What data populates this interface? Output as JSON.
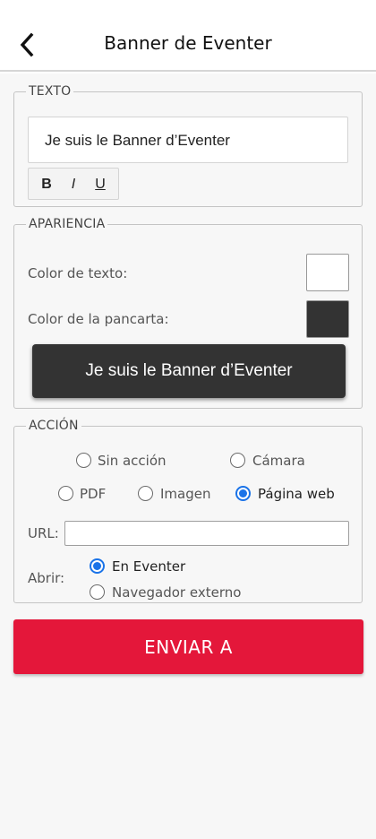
{
  "header": {
    "title": "Banner de Eventer",
    "back_icon": "chevron-left-icon"
  },
  "texto": {
    "legend": "TEXTO",
    "value": "Je suis le Banner d’Eventer",
    "format": {
      "bold": "B",
      "italic": "I",
      "underline": "U"
    }
  },
  "apariencia": {
    "legend": "APARIENCIA",
    "text_color_label": "Color de texto:",
    "text_color": "#ffffff",
    "banner_color_label": "Color de la pancarta:",
    "banner_color": "#333333",
    "preview_text": "Je suis le Banner d’Eventer"
  },
  "accion": {
    "legend": "ACCIÓN",
    "options": {
      "none": "Sin acción",
      "camera": "Cámara",
      "pdf": "PDF",
      "image": "Imagen",
      "web": "Página web"
    },
    "selected": "web",
    "url_label": "URL:",
    "url_value": "",
    "open_label": "Abrir:",
    "open_options": {
      "eventer": "En Eventer",
      "external": "Navegador externo"
    },
    "open_selected": "eventer"
  },
  "send_button": {
    "label": "ENVIAR A",
    "color": "#e4173a"
  },
  "accent_color": "#1a73e8"
}
